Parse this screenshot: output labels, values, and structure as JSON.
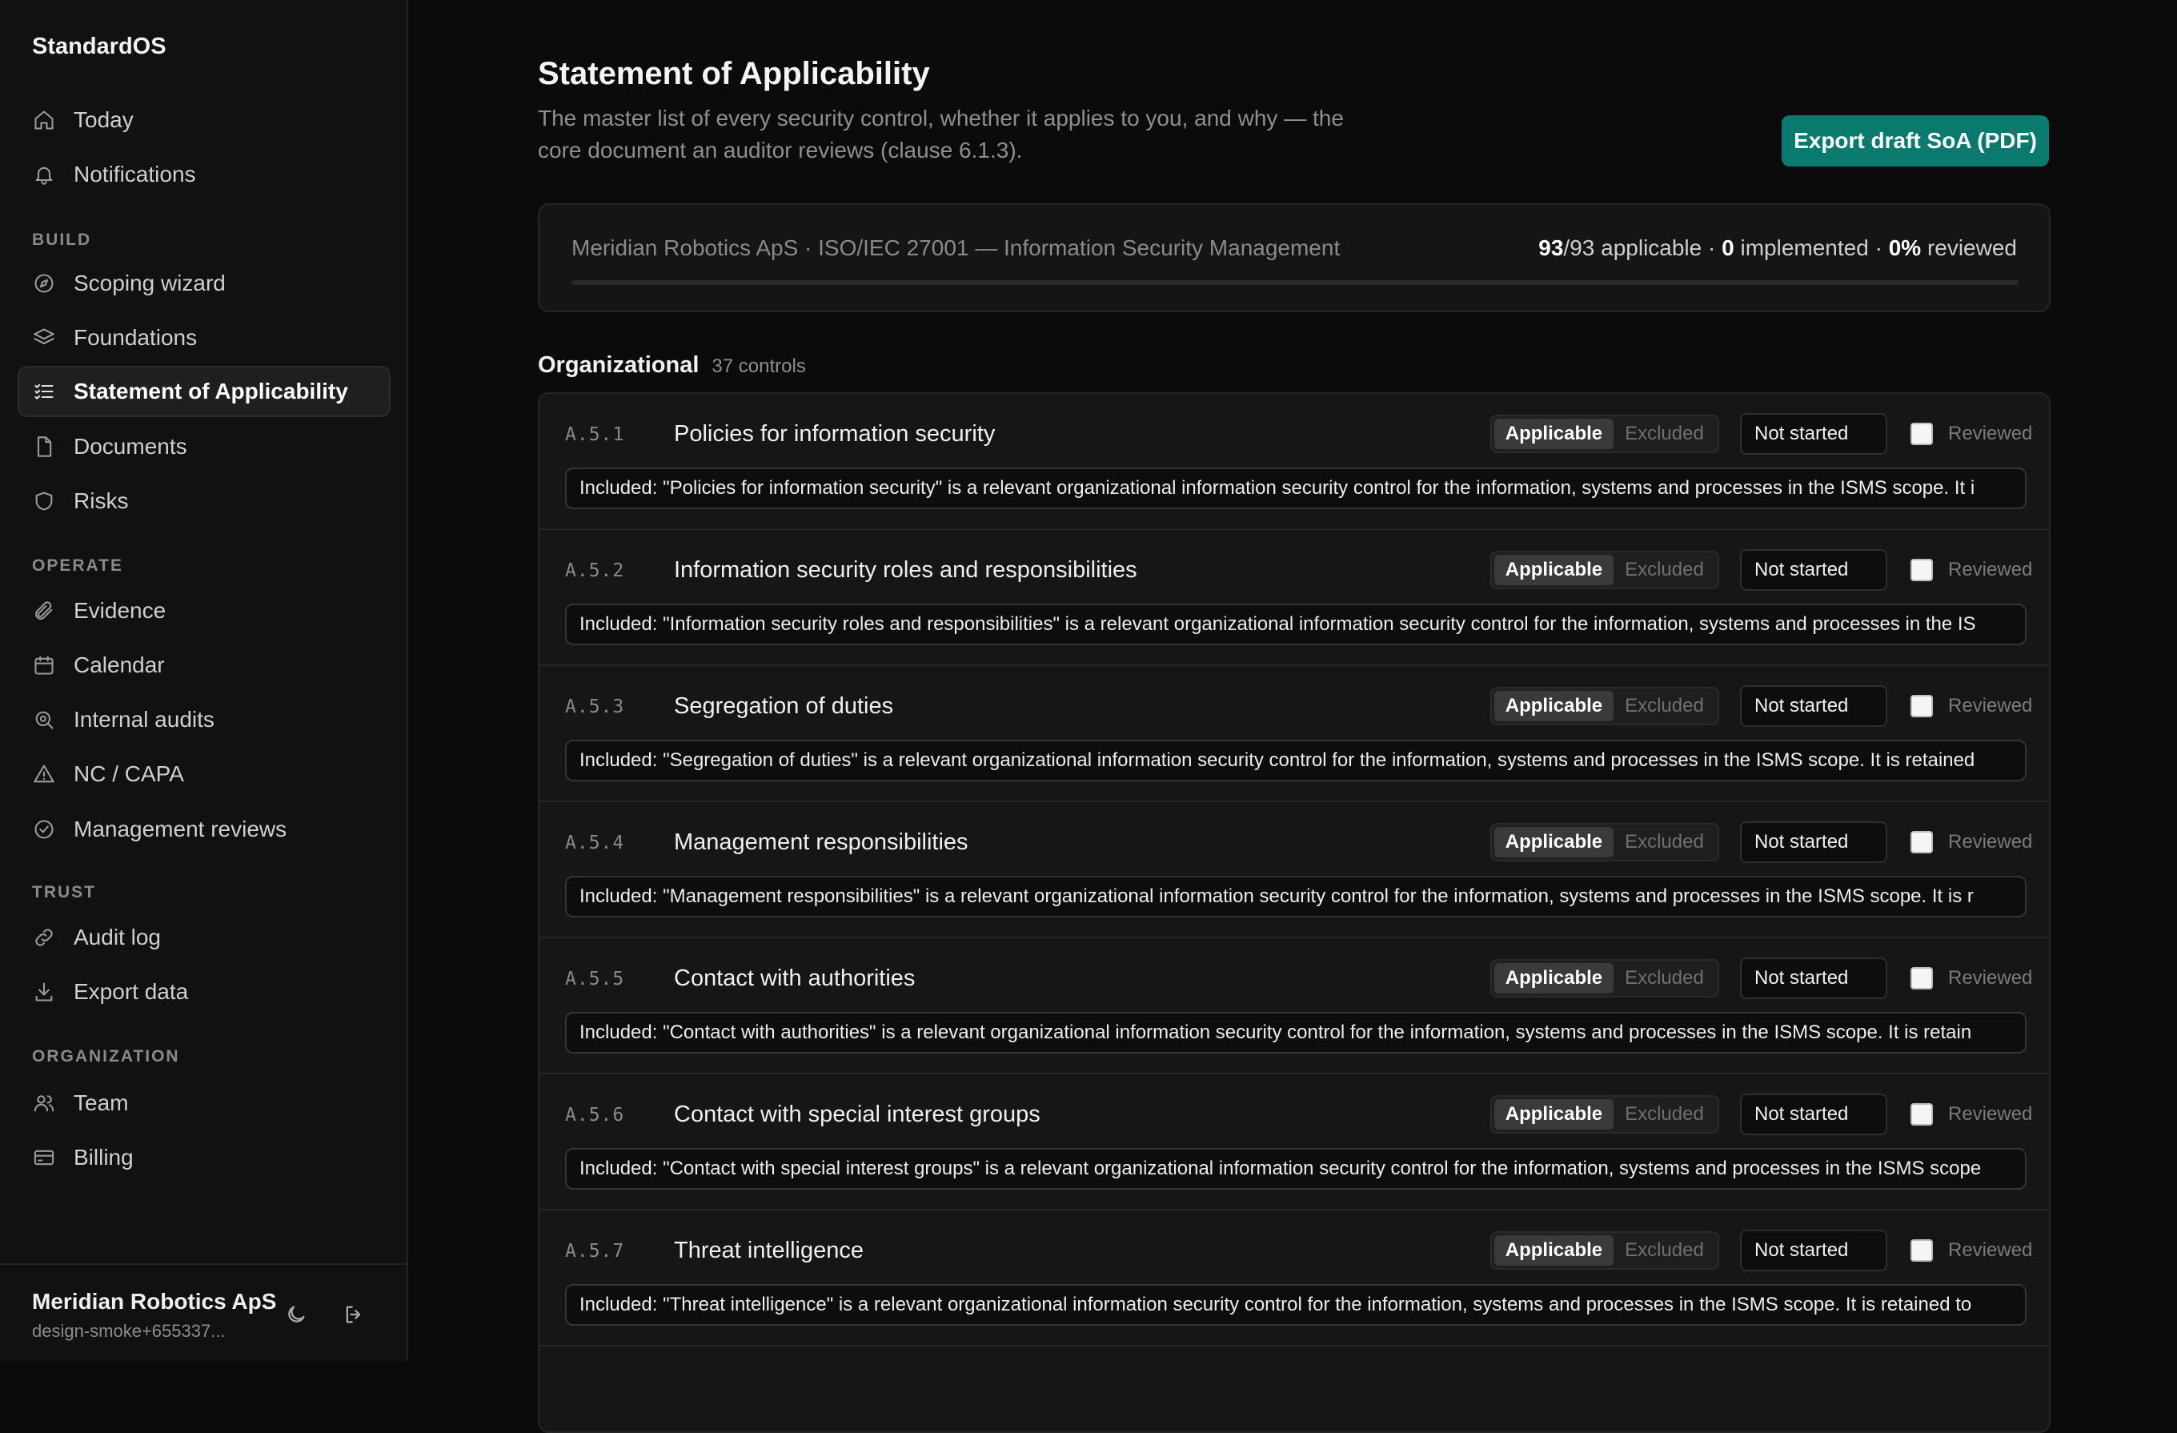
{
  "app": {
    "name": "StandardOS"
  },
  "sidebar": {
    "top_items": [
      {
        "label": "Today",
        "icon": "home-icon"
      },
      {
        "label": "Notifications",
        "icon": "bell-icon"
      }
    ],
    "sections": [
      {
        "label": "BUILD",
        "items": [
          {
            "label": "Scoping wizard",
            "icon": "compass-icon"
          },
          {
            "label": "Foundations",
            "icon": "layers-icon"
          },
          {
            "label": "Statement of Applicability",
            "icon": "checklist-icon",
            "active": true
          },
          {
            "label": "Documents",
            "icon": "file-icon"
          },
          {
            "label": "Risks",
            "icon": "shield-icon"
          }
        ]
      },
      {
        "label": "OPERATE",
        "items": [
          {
            "label": "Evidence",
            "icon": "paperclip-icon"
          },
          {
            "label": "Calendar",
            "icon": "calendar-icon"
          },
          {
            "label": "Internal audits",
            "icon": "search-icon"
          },
          {
            "label": "NC / CAPA",
            "icon": "warning-icon"
          },
          {
            "label": "Management reviews",
            "icon": "check-circle-icon"
          }
        ]
      },
      {
        "label": "TRUST",
        "items": [
          {
            "label": "Audit log",
            "icon": "link-icon"
          },
          {
            "label": "Export data",
            "icon": "download-icon"
          }
        ]
      },
      {
        "label": "ORGANIZATION",
        "items": [
          {
            "label": "Team",
            "icon": "users-icon"
          },
          {
            "label": "Billing",
            "icon": "credit-card-icon"
          }
        ]
      }
    ],
    "footer": {
      "org_name": "Meridian Robotics ApS",
      "user_email": "design-smoke+655337..."
    }
  },
  "page": {
    "title": "Statement of Applicability",
    "description": "The master list of every security control, whether it applies to you, and why — the core document an auditor reviews (clause 6.1.3).",
    "export_button": "Export draft SoA (PDF)"
  },
  "summary": {
    "context": "Meridian Robotics ApS · ISO/IEC 27001 — Information Security Management",
    "applicable": "93",
    "total": "93",
    "applicable_label": "applicable",
    "implemented": "0",
    "implemented_label": "implemented",
    "reviewed_pct": "0%",
    "reviewed_label": "reviewed",
    "progress": 0
  },
  "section": {
    "title": "Organizational",
    "count": "37 controls"
  },
  "labels": {
    "applicable": "Applicable",
    "excluded": "Excluded",
    "reviewed": "Reviewed"
  },
  "controls": [
    {
      "id": "A.5.1",
      "title": "Policies for information security",
      "applicability": "Applicable",
      "status": "Not started",
      "reviewed": false,
      "justification": "Included: \"Policies for information security\" is a relevant organizational information security control for the information, systems and processes in the ISMS scope. It i"
    },
    {
      "id": "A.5.2",
      "title": "Information security roles and responsibilities",
      "applicability": "Applicable",
      "status": "Not started",
      "reviewed": false,
      "justification": "Included: \"Information security roles and responsibilities\" is a relevant organizational information security control for the information, systems and processes in the IS"
    },
    {
      "id": "A.5.3",
      "title": "Segregation of duties",
      "applicability": "Applicable",
      "status": "Not started",
      "reviewed": false,
      "justification": "Included: \"Segregation of duties\" is a relevant organizational information security control for the information, systems and processes in the ISMS scope. It is retained"
    },
    {
      "id": "A.5.4",
      "title": "Management responsibilities",
      "applicability": "Applicable",
      "status": "Not started",
      "reviewed": false,
      "justification": "Included: \"Management responsibilities\" is a relevant organizational information security control for the information, systems and processes in the ISMS scope. It is r"
    },
    {
      "id": "A.5.5",
      "title": "Contact with authorities",
      "applicability": "Applicable",
      "status": "Not started",
      "reviewed": false,
      "justification": "Included: \"Contact with authorities\" is a relevant organizational information security control for the information, systems and processes in the ISMS scope. It is retain"
    },
    {
      "id": "A.5.6",
      "title": "Contact with special interest groups",
      "applicability": "Applicable",
      "status": "Not started",
      "reviewed": false,
      "justification": "Included: \"Contact with special interest groups\" is a relevant organizational information security control for the information, systems and processes in the ISMS scope"
    },
    {
      "id": "A.5.7",
      "title": "Threat intelligence",
      "applicability": "Applicable",
      "status": "Not started",
      "reviewed": false,
      "justification": "Included: \"Threat intelligence\" is a relevant organizational information security control for the information, systems and processes in the ISMS scope. It is retained to"
    },
    {
      "id": "",
      "title": "",
      "applicability": "",
      "status": "",
      "reviewed": false,
      "justification": ""
    }
  ],
  "colors": {
    "accent": "#0b7a6e",
    "background": "#0b0b0b",
    "sidebar": "#111111",
    "card": "#161616"
  }
}
